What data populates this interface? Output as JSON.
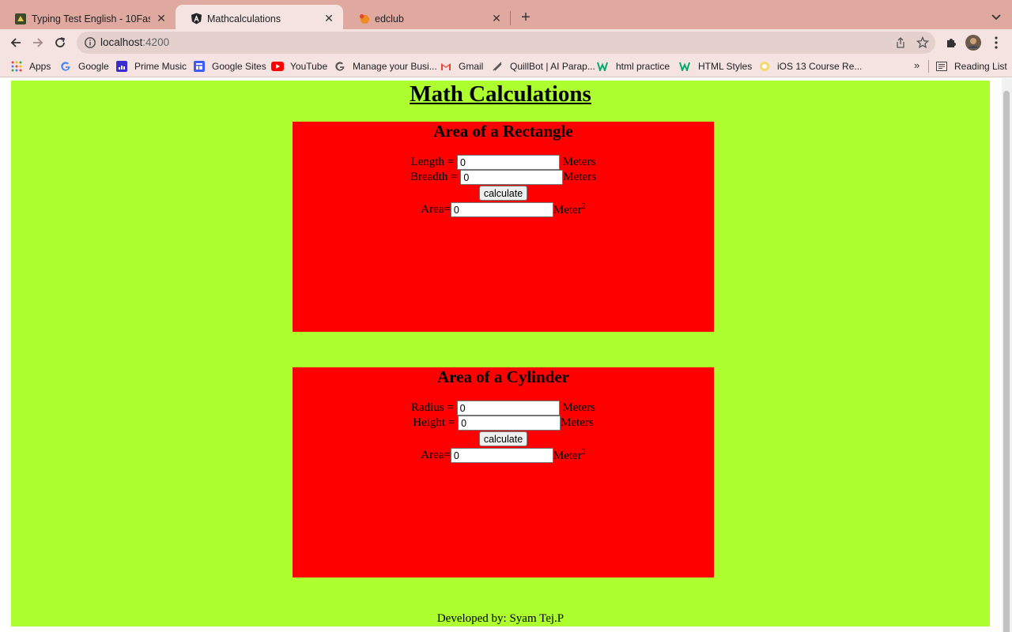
{
  "browser": {
    "tabs": [
      {
        "title": "Typing Test English - 10FastFingers",
        "favicon": "10fastfingers-icon"
      },
      {
        "title": "Mathcalculations",
        "favicon": "angular-icon"
      },
      {
        "title": "edclub",
        "favicon": "edclub-icon"
      }
    ],
    "url": {
      "host": "localhost",
      "port": ":4200"
    },
    "bookmarks": [
      {
        "label": "Apps",
        "icon": "apps-grid-icon"
      },
      {
        "label": "Google",
        "icon": "google-icon"
      },
      {
        "label": "Prime Music",
        "icon": "prime-music-icon"
      },
      {
        "label": "Google Sites",
        "icon": "google-sites-icon"
      },
      {
        "label": "YouTube",
        "icon": "youtube-icon"
      },
      {
        "label": "Manage your Busi...",
        "icon": "google-icon"
      },
      {
        "label": "Gmail",
        "icon": "gmail-icon"
      },
      {
        "label": "QuillBot | AI Parap...",
        "icon": "quillbot-icon"
      },
      {
        "label": "html practice",
        "icon": "w3schools-icon"
      },
      {
        "label": "HTML Styles",
        "icon": "w3schools-icon"
      },
      {
        "label": "iOS 13 Course Re...",
        "icon": "course-icon"
      }
    ],
    "bookmarks_more": "»",
    "reading_list": "Reading List"
  },
  "page": {
    "title": "Math Calculations",
    "rectangle": {
      "heading": "Area of a Rectangle",
      "length_label": "Length =",
      "length_value": "0",
      "breadth_label": "Breadth =",
      "breadth_value": "0",
      "unit": "Meters",
      "button": "calculate",
      "area_label": "Area=",
      "area_value": "0",
      "area_unit": "Meter",
      "area_exp": "2"
    },
    "cylinder": {
      "heading": "Area of a Cylinder",
      "radius_label": "Radius =",
      "radius_value": "0",
      "height_label": "Height =",
      "height_value": "0",
      "unit": "Meters",
      "button": "calculate",
      "area_label": "Area=",
      "area_value": "0",
      "area_unit": "Meter",
      "area_exp": "2"
    },
    "footer": "Developed by: Syam Tej.P"
  },
  "colors": {
    "page_background": "#adff2f",
    "card_background": "#ff0000",
    "tabbar": "#e0a9a0"
  }
}
